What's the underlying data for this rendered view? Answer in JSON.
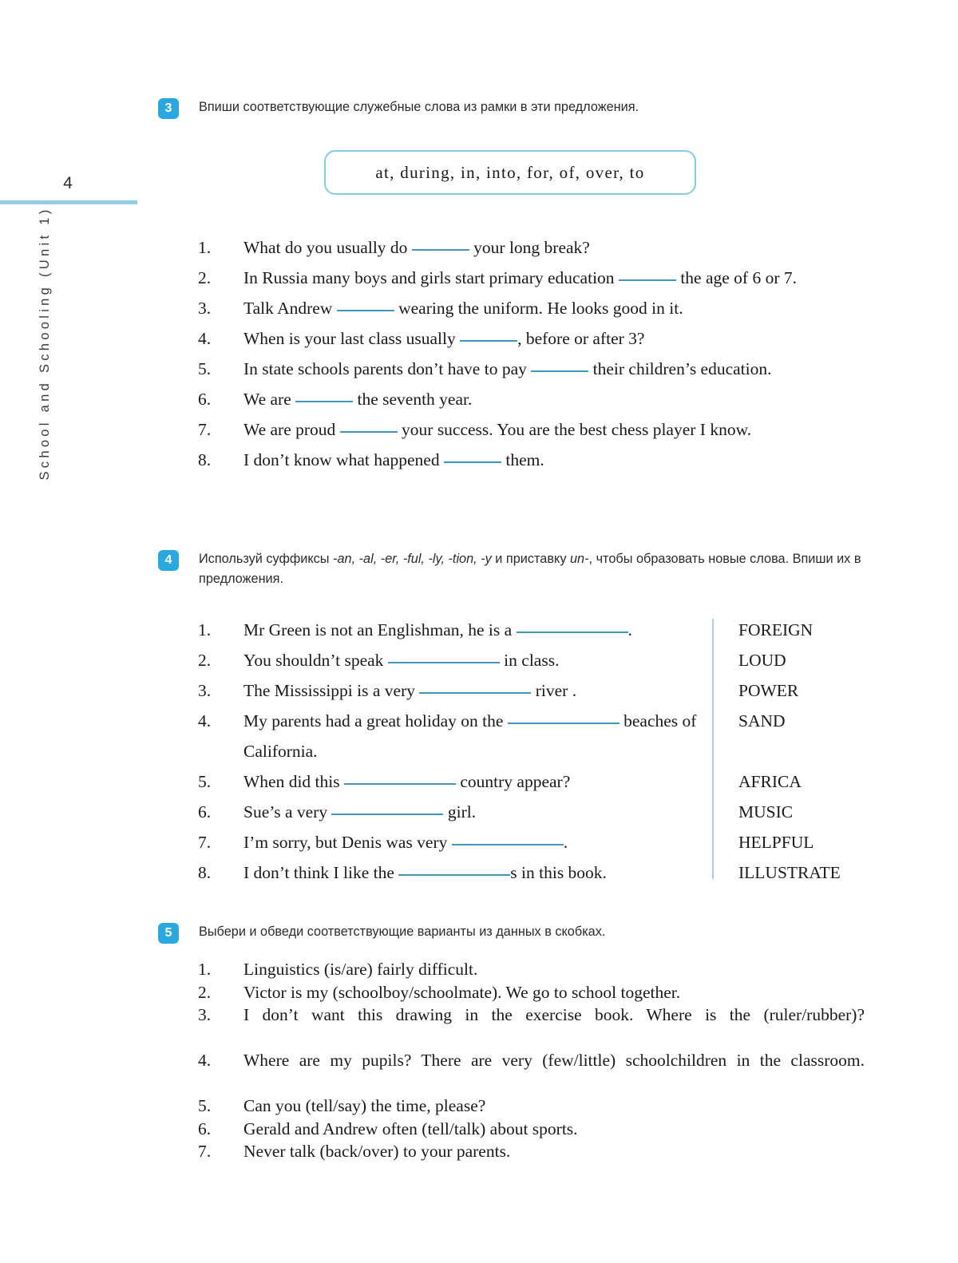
{
  "margin": {
    "page_number": "4",
    "running_title": "School and Schooling (Unit 1)",
    "rule_color": "#92cfe4"
  },
  "theme": {
    "badge_color": "#29a9e0",
    "frame_border_color": "#84ccdf",
    "blank_line_color": "#3f97bd",
    "divider_color": "#9fd3dd"
  },
  "exercises": [
    {
      "number": "3",
      "instruction": "Впиши соответствующие служебные слова из рамки в эти предложения.",
      "word_bank": "at,  during,  in,  into,  for,  of,  over,  to",
      "items": [
        {
          "num": "1.",
          "before": "What do you usually do ",
          "after": " your long break?"
        },
        {
          "num": "2.",
          "before": "In Russia many boys and girls start primary education ",
          "after": " the age of 6 or 7."
        },
        {
          "num": "3.",
          "before": "Talk Andrew ",
          "after": " wearing the uniform. He looks good in it."
        },
        {
          "num": "4.",
          "before": "When is your last class usually ",
          "after": ", before or after 3?"
        },
        {
          "num": "5.",
          "before": "In state schools parents don’t have to pay ",
          "after": " their children’s education."
        },
        {
          "num": "6.",
          "before": "We are ",
          "after": " the seventh year."
        },
        {
          "num": "7.",
          "before": "We are proud ",
          "after": " your success. You are the best chess player I know."
        },
        {
          "num": "8.",
          "before": "I don’t know what happened ",
          "after": " them."
        }
      ]
    },
    {
      "number": "4",
      "instruction_part1": "Используй суффиксы ",
      "instruction_suffixes": "-an, -al, -er, -ful, -ly, -tion, -y",
      "instruction_part2": " и приставку ",
      "instruction_prefix": "un-",
      "instruction_part3": ", чтобы образовать новые слова. Впиши их в предложения.",
      "items": [
        {
          "num": "1.",
          "before": "Mr Green is not an Englishman, he is a ",
          "after": "."
        },
        {
          "num": "2.",
          "before": "You shouldn’t speak ",
          "after": " in class."
        },
        {
          "num": "3.",
          "before": "The Mississippi is a very ",
          "after": " river ."
        },
        {
          "num": "4.",
          "before": "My parents had a great holiday on the ",
          "after": " beaches of California."
        },
        {
          "num": "5.",
          "before": "When did this ",
          "after": " country appear?"
        },
        {
          "num": "6.",
          "before": "Sue’s a very ",
          "after": " girl."
        },
        {
          "num": "7.",
          "before": "I’m sorry, but Denis was very ",
          "after": "."
        },
        {
          "num": "8.",
          "before": "I don’t think I like the ",
          "after": "s in this book."
        }
      ],
      "words": [
        "FOREIGN",
        "LOUD",
        "POWER",
        "SAND",
        "",
        "AFRICA",
        "MUSIC",
        "HELPFUL",
        "ILLUSTRATE"
      ]
    },
    {
      "number": "5",
      "instruction": "Выбери и обведи соответствующие варианты из данных в скобках.",
      "items": [
        {
          "num": "1.",
          "text": "Linguistics (is/are) fairly difficult."
        },
        {
          "num": "2.",
          "text": "Victor is my (schoolboy/schoolmate). We go to school together."
        },
        {
          "num": "3.",
          "text": "I don’t want this drawing in the exercise book. Where is the (ruler/rubber)?"
        },
        {
          "num": "4.",
          "text": "Where are my pupils? There are very (few/little) schoolchildren in the classroom."
        },
        {
          "num": "5.",
          "text": "Can you (tell/say) the time, please?"
        },
        {
          "num": "6.",
          "text": "Gerald and Andrew often (tell/talk) about sports."
        },
        {
          "num": "7.",
          "text": "Never talk (back/over) to your parents."
        }
      ]
    }
  ]
}
